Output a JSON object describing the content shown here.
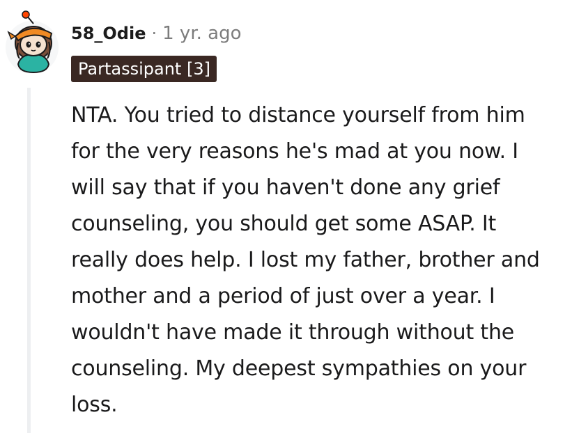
{
  "comment": {
    "author": "58_Odie",
    "separator": "·",
    "timestamp": "1 yr. ago",
    "flair": "Partassipant [3]",
    "body": "NTA. You tried to distance yourself from him for the very reasons he's mad at you now. I will say that if you haven't done any grief counseling, you should get some ASAP. It really does help. I lost my father, brother and mother and a period of just over a year. I wouldn't have made it through without the counseling. My deepest sympathies on your loss."
  },
  "colors": {
    "flair_background": "#3a2823",
    "flair_text": "#ffffff",
    "meta_text": "#7c7c7c",
    "thread_line": "#edeff1",
    "avatar_bandana": "#f08a24",
    "avatar_shirt": "#2bb3a3",
    "avatar_hair": "#7a4f3a"
  },
  "icons": {
    "avatar": "snoo-avatar-icon"
  }
}
